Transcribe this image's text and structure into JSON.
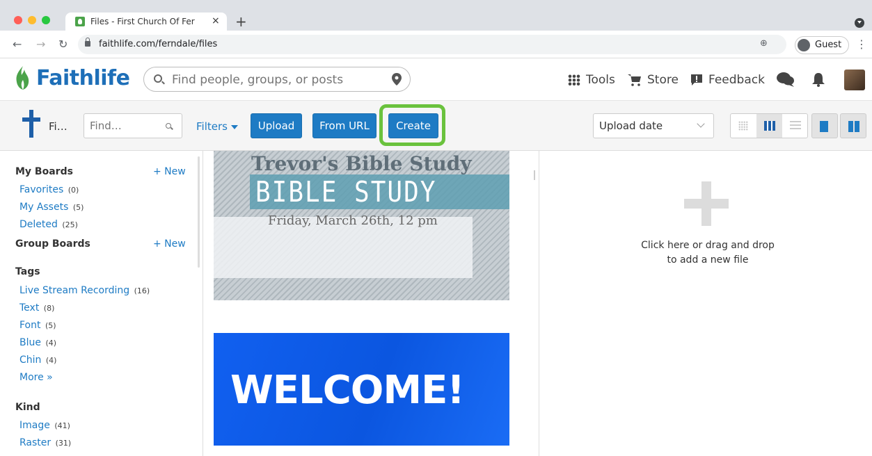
{
  "browser": {
    "tab_title": "Files - First Church Of Ferndale",
    "tab_close": "×",
    "new_tab": "+",
    "url": "faithlife.com/ferndale/files",
    "profile_label": "Guest"
  },
  "header": {
    "logo_text": "Faithlife",
    "search_placeholder": "Find people, groups, or posts",
    "tools_label": "Tools",
    "store_label": "Store",
    "feedback_label": "Feedback"
  },
  "toolbar": {
    "title": "Fi…",
    "find_placeholder": "Find…",
    "filters_label": "Filters",
    "upload_label": "Upload",
    "from_url_label": "From URL",
    "create_label": "Create",
    "sort_label": "Upload date"
  },
  "sidebar": {
    "my_boards": {
      "heading": "My Boards",
      "new_label": "+ New",
      "items": [
        {
          "label": "Favorites",
          "count": "(0)"
        },
        {
          "label": "My Assets",
          "count": "(5)"
        },
        {
          "label": "Deleted",
          "count": "(25)"
        }
      ]
    },
    "group_boards": {
      "heading": "Group Boards",
      "new_label": "+ New"
    },
    "tags": {
      "heading": "Tags",
      "items": [
        {
          "label": "Live Stream Recording",
          "count": "(16)"
        },
        {
          "label": "Text",
          "count": "(8)"
        },
        {
          "label": "Font",
          "count": "(5)"
        },
        {
          "label": "Blue",
          "count": "(4)"
        },
        {
          "label": "Chin",
          "count": "(4)"
        }
      ],
      "more_label": "More »"
    },
    "kind": {
      "heading": "Kind",
      "items": [
        {
          "label": "Image",
          "count": "(41)"
        },
        {
          "label": "Raster",
          "count": "(31)"
        }
      ]
    }
  },
  "content": {
    "thumb1": {
      "title": "Trevor's Bible Study",
      "banner": "BIBLE STUDY",
      "date": "Friday, March 26th, 12 pm"
    },
    "thumb2": {
      "text": "WELCOME!"
    }
  },
  "dropzone": {
    "line1": "Click here or drag and drop",
    "line2": "to add a new file"
  },
  "colors": {
    "accent": "#1e7bc4",
    "highlight": "#6ac23d",
    "logo_green": "#4ba34a"
  }
}
